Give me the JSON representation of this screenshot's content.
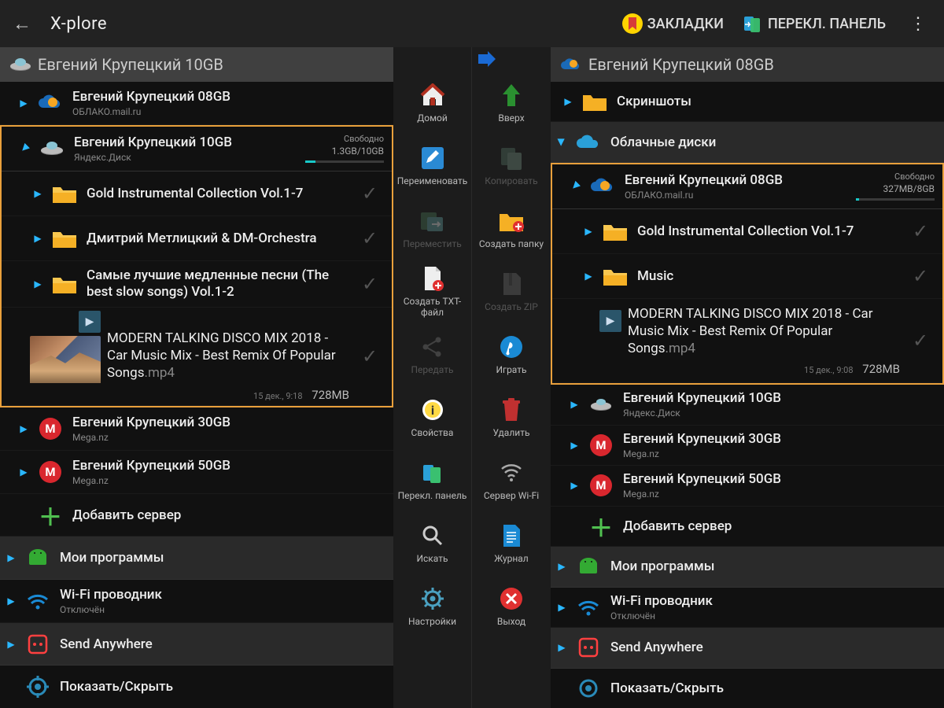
{
  "header": {
    "title": "X-plore",
    "bookmarks": "ЗАКЛАДКИ",
    "switch_panel": "ПЕРЕКЛ. ПАНЕЛЬ"
  },
  "left": {
    "path": "Евгений Крупецкий 10GB",
    "account08": {
      "title": "Евгений Крупецкий 08GB",
      "sub": "ОБЛАКО.mail.ru"
    },
    "account10": {
      "title": "Евгений Крупецкий 10GB",
      "sub": "Яндекс.Диск",
      "free_label": "Свободно",
      "free_value": "1.3GB/10GB"
    },
    "folders": [
      {
        "name": "Gold Instrumental Collection Vol.1-7"
      },
      {
        "name": "Дмитрий Метлицкий & DM-Orchestra"
      },
      {
        "name": "Самые лучшие медленные песни (The best slow songs) Vol.1-2"
      }
    ],
    "file": {
      "name": "MODERN TALKING DISCO MIX 2018 - Car Music Mix - Best Remix Of Popular Songs",
      "ext": ".mp4",
      "date": "15 дек., 9:18",
      "size": "728MB"
    },
    "account30": {
      "title": "Евгений Крупецкий 30GB",
      "sub": "Mega.nz"
    },
    "account50": {
      "title": "Евгений Крупецкий 50GB",
      "sub": "Mega.nz"
    },
    "add_server": "Добавить сервер",
    "my_apps": "Мои программы",
    "wifi": {
      "title": "Wi-Fi проводник",
      "sub": "Отключён"
    },
    "send_anywhere": "Send Anywhere",
    "show_hide": "Показать/Скрыть"
  },
  "right": {
    "path": "Евгений Крупецкий 08GB",
    "screenshots": "Скриншоты",
    "cloud_disks": "Облачные диски",
    "account08": {
      "title": "Евгений Крупецкий 08GB",
      "sub": "ОБЛАКО.mail.ru",
      "free_label": "Свободно",
      "free_value": "327MB/8GB"
    },
    "folders": [
      {
        "name": "Gold Instrumental Collection Vol.1-7"
      },
      {
        "name": "Music"
      }
    ],
    "file": {
      "name": "MODERN TALKING DISCO MIX 2018 - Car Music Mix - Best Remix Of Popular Songs",
      "ext": ".mp4",
      "date": "15 дек., 9:08",
      "size": "728MB"
    },
    "account10": {
      "title": "Евгений Крупецкий 10GB",
      "sub": "Яндекс.Диск"
    },
    "account30": {
      "title": "Евгений Крупецкий 30GB",
      "sub": "Mega.nz"
    },
    "account50": {
      "title": "Евгений Крупецкий 50GB",
      "sub": "Mega.nz"
    },
    "add_server": "Добавить сервер",
    "my_apps": "Мои программы",
    "wifi": {
      "title": "Wi-Fi проводник",
      "sub": "Отключён"
    },
    "send_anywhere": "Send Anywhere",
    "show_hide": "Показать/Скрыть"
  },
  "center": {
    "home": "Домой",
    "up": "Вверх",
    "rename": "Переименовать",
    "copy": "Копировать",
    "move": "Переместить",
    "new_folder": "Создать папку",
    "new_txt": "Создать TXT-файл",
    "create_zip": "Создать ZIP",
    "share": "Передать",
    "play": "Играть",
    "properties": "Свойства",
    "delete": "Удалить",
    "switch": "Перекл. панель",
    "wifi_server": "Сервер Wi-Fi",
    "search": "Искать",
    "log": "Журнал",
    "settings": "Настройки",
    "exit": "Выход"
  }
}
